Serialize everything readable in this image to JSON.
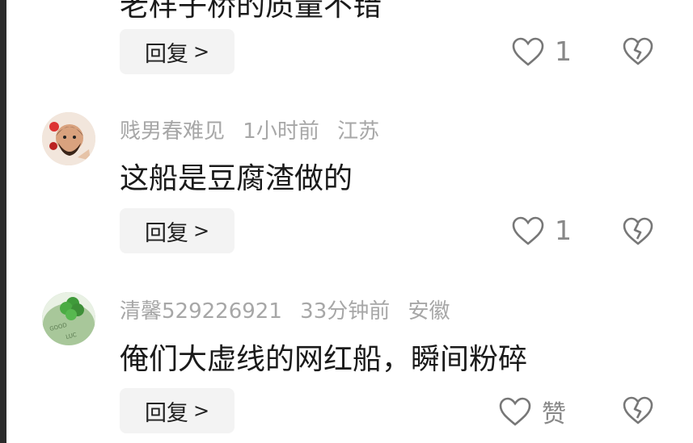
{
  "top_comment": {
    "text_fragment": "老样子桥的质量不错",
    "reply_label": "回复",
    "like_count": "1"
  },
  "comments": [
    {
      "username": "贱男春难见",
      "time": "1小时前",
      "location": "江苏",
      "text": "这船是豆腐渣做的",
      "reply_label": "回复",
      "like_count": "1"
    },
    {
      "username": "清馨529226921",
      "time": "33分钟前",
      "location": "安徽",
      "text": "俺们大虚线的网红船，瞬间粉碎",
      "reply_label": "回复",
      "like_count": "赞",
      "avatar_text": "GOOD LUCK"
    }
  ],
  "icons": {
    "reply_chevron": "chevron-right-icon",
    "like": "heart-outline-icon",
    "dislike": "broken-heart-icon"
  },
  "colors": {
    "meta_gray": "#a7a7a7",
    "button_bg": "#f3f3f3",
    "icon_gray": "#888888"
  }
}
